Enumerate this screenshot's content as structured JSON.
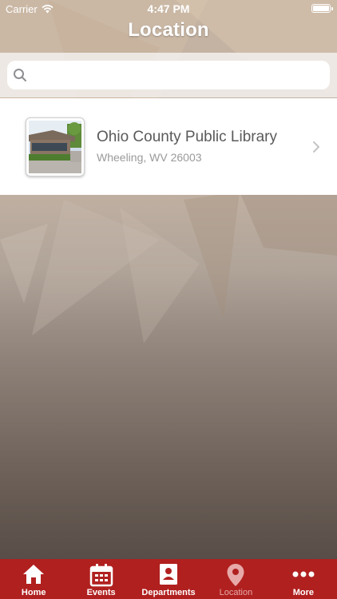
{
  "status": {
    "carrier": "Carrier",
    "time": "4:47 PM"
  },
  "nav": {
    "title": "Location"
  },
  "search": {
    "placeholder": "",
    "value": ""
  },
  "locations": [
    {
      "name": "Ohio County Public Library",
      "address": "Wheeling, WV 26003"
    }
  ],
  "tabs": [
    {
      "label": "Home",
      "icon": "home-icon"
    },
    {
      "label": "Events",
      "icon": "calendar-icon"
    },
    {
      "label": "Departments",
      "icon": "badge-icon"
    },
    {
      "label": "Location",
      "icon": "location-pin-icon",
      "active": true
    },
    {
      "label": "More",
      "icon": "more-icon"
    }
  ],
  "colors": {
    "tabbar": "#b0201f",
    "tab_active": "#e6a9a8"
  }
}
